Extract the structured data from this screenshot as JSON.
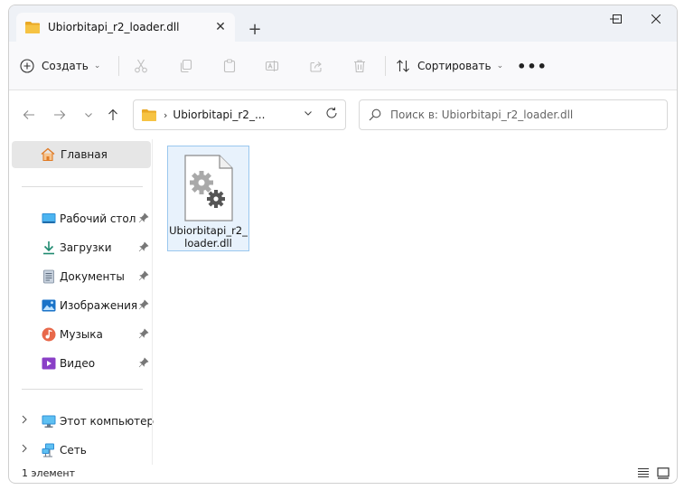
{
  "window": {
    "tab_title": "Ubiorbitapi_r2_loader.dll",
    "tab_close": "✕",
    "new_tab": "+"
  },
  "toolbar": {
    "create_label": "Создать",
    "sort_label": "Сортировать",
    "more_label": "•••"
  },
  "address": {
    "path": "Ubiorbitapi_r2_...",
    "search_placeholder": "Поиск в: Ubiorbitapi_r2_loader.dll"
  },
  "sidebar": {
    "home_label": "Главная",
    "quick_access": [
      {
        "label": "Рабочий стол",
        "icon": "desktop-icon"
      },
      {
        "label": "Загрузки",
        "icon": "download-icon"
      },
      {
        "label": "Документы",
        "icon": "documents-icon"
      },
      {
        "label": "Изображения",
        "icon": "pictures-icon"
      },
      {
        "label": "Музыка",
        "icon": "music-icon"
      },
      {
        "label": "Видео",
        "icon": "video-icon"
      }
    ],
    "locations": [
      {
        "label": "Этот компьютер",
        "icon": "computer-icon"
      },
      {
        "label": "Сеть",
        "icon": "network-icon"
      }
    ]
  },
  "content": {
    "file_name_line1": "Ubiorbitapi_r2_",
    "file_name_line2": "loader.dll"
  },
  "status": {
    "item_count": "1 элемент"
  },
  "colors": {
    "accent": "#0067c0",
    "folder": "#f6c343",
    "selection": "#e8f2fc"
  }
}
